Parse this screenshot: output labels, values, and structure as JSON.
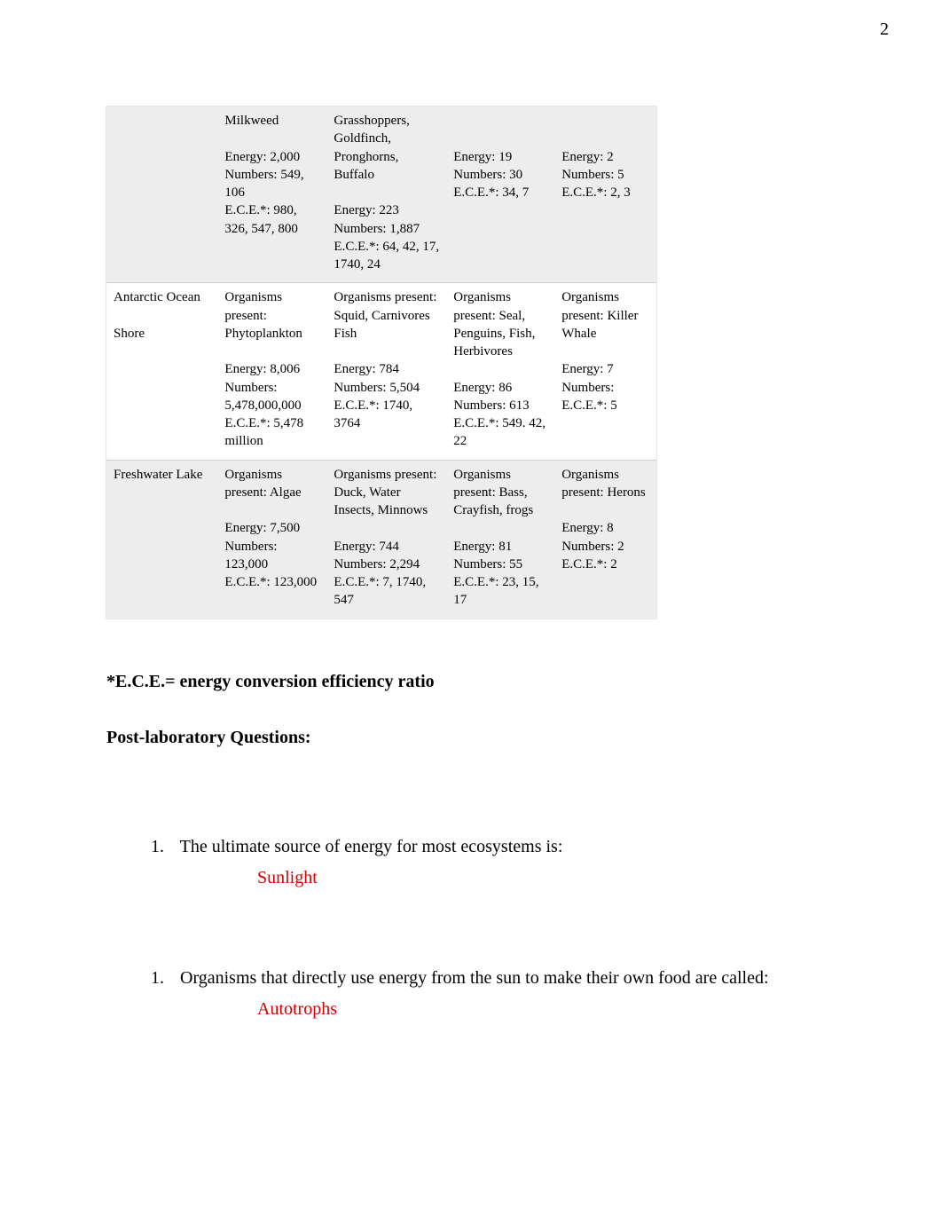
{
  "page_number": "2",
  "table": {
    "rows": [
      {
        "c1": "",
        "c2": "Milkweed\n\nEnergy: 2,000\nNumbers: 549, 106\nE.C.E.*: 980, 326, 547, 800",
        "c3": "Grasshoppers, Goldfinch, Pronghorns, Buffalo\n\nEnergy: 223\nNumbers: 1,887\nE.C.E.*: 64, 42, 17, 1740, 24",
        "c4": "\n\nEnergy: 19\nNumbers: 30\nE.C.E.*: 34, 7",
        "c5": "\n\nEnergy: 2\nNumbers: 5\nE.C.E.*: 2, 3"
      },
      {
        "c1": "Antarctic Ocean\n\nShore",
        "c2": "Organisms present: Phytoplankton\n\nEnergy: 8,006\nNumbers: 5,478,000,000\nE.C.E.*: 5,478 million",
        "c3": "Organisms present: Squid, Carnivores Fish\n\nEnergy: 784\nNumbers: 5,504\nE.C.E.*: 1740, 3764",
        "c4": "Organisms present: Seal, Penguins, Fish, Herbivores\n\nEnergy: 86\nNumbers: 613\nE.C.E.*: 549. 42, 22",
        "c5": "Organisms present: Killer Whale\n\nEnergy: 7\nNumbers:\nE.C.E.*: 5"
      },
      {
        "c1": "Freshwater Lake",
        "c2": "Organisms present: Algae\n\nEnergy: 7,500\nNumbers: 123,000\nE.C.E.*: 123,000",
        "c3": "Organisms present: Duck, Water Insects, Minnows\n\nEnergy: 744\nNumbers: 2,294\nE.C.E.*: 7, 1740, 547",
        "c4": "Organisms present: Bass, Crayfish, frogs\n\nEnergy: 81\nNumbers: 55\nE.C.E.*: 23, 15, 17",
        "c5": "Organisms present: Herons\n\nEnergy: 8\nNumbers: 2\nE.C.E.*: 2"
      }
    ]
  },
  "footnote": "*E.C.E.= energy conversion efficiency ratio",
  "post_lab_heading": "Post-laboratory Questions:",
  "questions": [
    {
      "num": "1.",
      "text": "The ultimate source of energy for most ecosystems is:",
      "answer": "Sunlight"
    },
    {
      "num": "1.",
      "text": "Organisms that directly use energy from the sun to make their own food are called:",
      "answer": "Autotrophs"
    }
  ]
}
